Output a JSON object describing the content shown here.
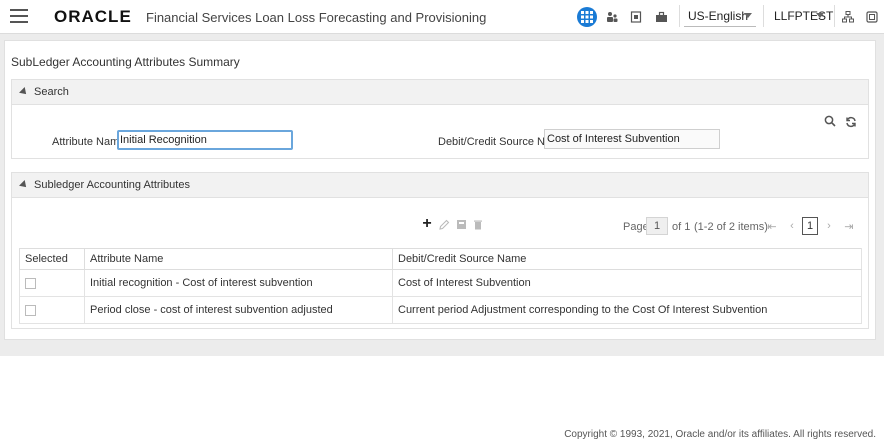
{
  "header": {
    "logo": "ORACLE",
    "app_name": "Financial Services Loan Loss Forecasting and Provisioning",
    "language": "US-English",
    "user": "LLFPTEST",
    "icons": [
      "menu-icon",
      "apps-grid-icon",
      "users-icon",
      "book-icon",
      "briefcase-icon",
      "hierarchy-icon",
      "window-icon"
    ]
  },
  "page": {
    "title": "SubLedger Accounting Attributes Summary"
  },
  "search": {
    "section_title": "Search",
    "attribute_name_label": "Attribute Name",
    "attribute_name_value": "Initial Recognition",
    "source_name_label": "Debit/Credit Source Name",
    "source_name_value": "Cost of Interest Subvention"
  },
  "attributes": {
    "section_title": "Subledger Accounting Attributes",
    "pager": {
      "page_label": "Page",
      "page_value": "1",
      "of_label": "of 1",
      "range_label": "(1-2 of 2 items)",
      "current_page": "1"
    },
    "columns": [
      "Selected",
      "Attribute Name",
      "Debit/Credit Source Name"
    ],
    "rows": [
      {
        "attribute_name": "Initial recognition - Cost of interest subvention",
        "source_name": "Cost of Interest Subvention"
      },
      {
        "attribute_name": "Period close - cost of interest subvention adjusted",
        "source_name": "Current period Adjustment corresponding to the Cost Of Interest Subvention"
      }
    ]
  },
  "footer": {
    "copyright": "Copyright © 1993, 2021, Oracle and/or its affiliates. All rights reserved."
  },
  "colors": {
    "accent": "#1a7bd5",
    "section_header_bg": "#f2f2f2",
    "page_bg": "#ececec"
  }
}
